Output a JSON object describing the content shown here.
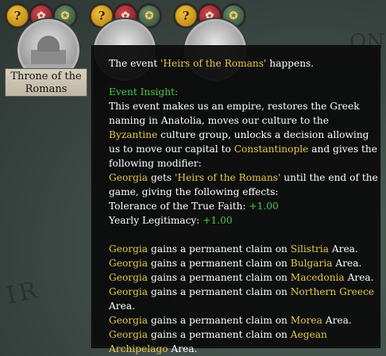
{
  "map": {
    "label_left": "IR",
    "label_right": "ON"
  },
  "missions": [
    {
      "icons": [
        {
          "name": "question-icon",
          "glyph": "?"
        },
        {
          "name": "rose-banner-icon",
          "glyph": "✿"
        },
        {
          "name": "medal-icon",
          "glyph": "✪"
        }
      ],
      "title": "Throne of the Romans"
    },
    {
      "icons": [
        {
          "name": "question-icon",
          "glyph": "?"
        },
        {
          "name": "rose-banner-icon",
          "glyph": "✿"
        },
        {
          "name": "medal-icon",
          "glyph": "✪"
        }
      ]
    },
    {
      "icons": [
        {
          "name": "question-icon",
          "glyph": "?"
        },
        {
          "name": "rose-banner-icon",
          "glyph": "✿"
        },
        {
          "name": "medal-icon",
          "glyph": "✪"
        }
      ]
    }
  ],
  "tooltip": {
    "intro_prefix": "The event ",
    "event_name": "'Heirs of the Romans'",
    "intro_suffix": " happens.",
    "insight_heading": "Event Insight:",
    "body": {
      "t1": "This event makes us an empire, restores the Greek naming in Anatolia, moves our culture to the ",
      "culture": "Byzantine",
      "t2": " culture group, unlocks a decision allowing us to move our capital to ",
      "capital": "Constantinople",
      "t3": " and gives the following modifier:",
      "country": "Georgia",
      "t4": " gets ",
      "modifier": "'Heirs of the Romans'",
      "t5": " until the end of the game, giving the following effects:"
    },
    "effects": [
      {
        "label": "Tolerance of the True Faith: ",
        "value": "+1.00"
      },
      {
        "label": "Yearly Legitimacy: ",
        "value": "+1.00"
      }
    ],
    "claims": [
      {
        "country": "Georgia",
        "text": " gains a permanent claim on ",
        "area": "Silistria",
        "suffix": " Area."
      },
      {
        "country": "Georgia",
        "text": " gains a permanent claim on ",
        "area": "Bulgaria",
        "suffix": " Area."
      },
      {
        "country": "Georgia",
        "text": " gains a permanent claim on ",
        "area": "Macedonia",
        "suffix": " Area."
      },
      {
        "country": "Georgia",
        "text": " gains a permanent claim on ",
        "area": "Northern Greece",
        "suffix": " Area."
      },
      {
        "country": "Georgia",
        "text": " gains a permanent claim on ",
        "area": "Morea",
        "suffix": " Area."
      },
      {
        "country": "Georgia",
        "text": " gains a permanent claim on ",
        "area": "Aegean Archipelago",
        "suffix": " Area."
      }
    ]
  }
}
